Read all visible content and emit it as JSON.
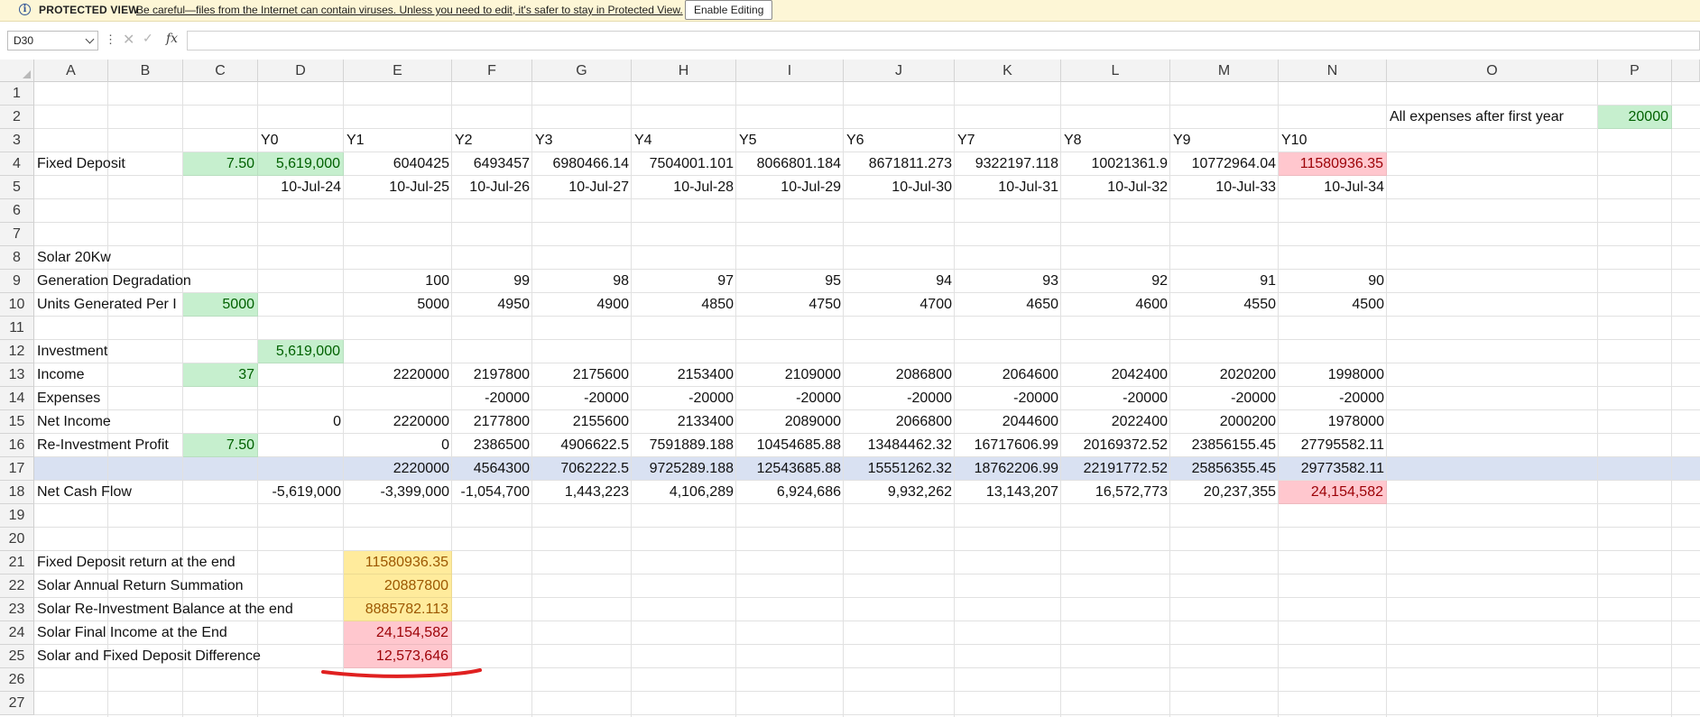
{
  "protected_view": {
    "icon": "info-icon",
    "label": "PROTECTED VIEW",
    "message": "Be careful—files from the Internet can contain viruses. Unless you need to edit, it's safer to stay in Protected View.",
    "button": "Enable Editing"
  },
  "formula_bar": {
    "name_box": "D30",
    "dots": "⋮",
    "cancel": "✕",
    "enter": "✓",
    "fx": "fx",
    "content": ""
  },
  "colors": {
    "green": "#c6efce",
    "red": "#ffc7ce",
    "yellow": "#ffeb9c",
    "blue_band": "#d9e1f2",
    "annotation": "#e02020"
  },
  "columns": [
    "A",
    "B",
    "C",
    "D",
    "E",
    "F",
    "G",
    "H",
    "I",
    "J",
    "K",
    "L",
    "M",
    "N",
    "O",
    "P"
  ],
  "rows": [
    "1",
    "2",
    "3",
    "4",
    "5",
    "6",
    "7",
    "8",
    "9",
    "10",
    "11",
    "12",
    "13",
    "14",
    "15",
    "16",
    "17",
    "18",
    "19",
    "20",
    "21",
    "22",
    "23",
    "24",
    "25",
    "26",
    "27"
  ],
  "cells": [
    {
      "ref": "O2",
      "text": "All expenses after first year",
      "align": "l"
    },
    {
      "ref": "P2",
      "text": "20000",
      "align": "r",
      "fill": "green"
    },
    {
      "ref": "D3",
      "text": "Y0",
      "align": "l"
    },
    {
      "ref": "E3",
      "text": "Y1",
      "align": "l"
    },
    {
      "ref": "F3",
      "text": "Y2",
      "align": "l"
    },
    {
      "ref": "G3",
      "text": "Y3",
      "align": "l"
    },
    {
      "ref": "H3",
      "text": "Y4",
      "align": "l"
    },
    {
      "ref": "I3",
      "text": "Y5",
      "align": "l"
    },
    {
      "ref": "J3",
      "text": "Y6",
      "align": "l"
    },
    {
      "ref": "K3",
      "text": "Y7",
      "align": "l"
    },
    {
      "ref": "L3",
      "text": "Y8",
      "align": "l"
    },
    {
      "ref": "M3",
      "text": "Y9",
      "align": "l"
    },
    {
      "ref": "N3",
      "text": "Y10",
      "align": "l"
    },
    {
      "ref": "A4",
      "text": "Fixed Deposit",
      "align": "l"
    },
    {
      "ref": "C4",
      "text": "7.50",
      "align": "r",
      "fill": "green"
    },
    {
      "ref": "D4",
      "text": "5,619,000",
      "align": "r",
      "fill": "green"
    },
    {
      "ref": "E4",
      "text": "6040425",
      "align": "r"
    },
    {
      "ref": "F4",
      "text": "6493457",
      "align": "r"
    },
    {
      "ref": "G4",
      "text": "6980466.14",
      "align": "r"
    },
    {
      "ref": "H4",
      "text": "7504001.101",
      "align": "r"
    },
    {
      "ref": "I4",
      "text": "8066801.184",
      "align": "r"
    },
    {
      "ref": "J4",
      "text": "8671811.273",
      "align": "r"
    },
    {
      "ref": "K4",
      "text": "9322197.118",
      "align": "r"
    },
    {
      "ref": "L4",
      "text": "10021361.9",
      "align": "r"
    },
    {
      "ref": "M4",
      "text": "10772964.04",
      "align": "r"
    },
    {
      "ref": "N4",
      "text": "11580936.35",
      "align": "r",
      "fill": "red"
    },
    {
      "ref": "D5",
      "text": "10-Jul-24",
      "align": "r"
    },
    {
      "ref": "E5",
      "text": "10-Jul-25",
      "align": "r"
    },
    {
      "ref": "F5",
      "text": "10-Jul-26",
      "align": "r"
    },
    {
      "ref": "G5",
      "text": "10-Jul-27",
      "align": "r"
    },
    {
      "ref": "H5",
      "text": "10-Jul-28",
      "align": "r"
    },
    {
      "ref": "I5",
      "text": "10-Jul-29",
      "align": "r"
    },
    {
      "ref": "J5",
      "text": "10-Jul-30",
      "align": "r"
    },
    {
      "ref": "K5",
      "text": "10-Jul-31",
      "align": "r"
    },
    {
      "ref": "L5",
      "text": "10-Jul-32",
      "align": "r"
    },
    {
      "ref": "M5",
      "text": "10-Jul-33",
      "align": "r"
    },
    {
      "ref": "N5",
      "text": "10-Jul-34",
      "align": "r"
    },
    {
      "ref": "A8",
      "text": "Solar 20Kw",
      "align": "l"
    },
    {
      "ref": "A9",
      "text": "Generation Degradation",
      "align": "l"
    },
    {
      "ref": "E9",
      "text": "100",
      "align": "r"
    },
    {
      "ref": "F9",
      "text": "99",
      "align": "r"
    },
    {
      "ref": "G9",
      "text": "98",
      "align": "r"
    },
    {
      "ref": "H9",
      "text": "97",
      "align": "r"
    },
    {
      "ref": "I9",
      "text": "95",
      "align": "r"
    },
    {
      "ref": "J9",
      "text": "94",
      "align": "r"
    },
    {
      "ref": "K9",
      "text": "93",
      "align": "r"
    },
    {
      "ref": "L9",
      "text": "92",
      "align": "r"
    },
    {
      "ref": "M9",
      "text": "91",
      "align": "r"
    },
    {
      "ref": "N9",
      "text": "90",
      "align": "r"
    },
    {
      "ref": "A10",
      "text": "Units Generated Per I",
      "align": "l"
    },
    {
      "ref": "C10",
      "text": "5000",
      "align": "r",
      "fill": "green"
    },
    {
      "ref": "E10",
      "text": "5000",
      "align": "r"
    },
    {
      "ref": "F10",
      "text": "4950",
      "align": "r"
    },
    {
      "ref": "G10",
      "text": "4900",
      "align": "r"
    },
    {
      "ref": "H10",
      "text": "4850",
      "align": "r"
    },
    {
      "ref": "I10",
      "text": "4750",
      "align": "r"
    },
    {
      "ref": "J10",
      "text": "4700",
      "align": "r"
    },
    {
      "ref": "K10",
      "text": "4650",
      "align": "r"
    },
    {
      "ref": "L10",
      "text": "4600",
      "align": "r"
    },
    {
      "ref": "M10",
      "text": "4550",
      "align": "r"
    },
    {
      "ref": "N10",
      "text": "4500",
      "align": "r"
    },
    {
      "ref": "A12",
      "text": "Investment",
      "align": "l"
    },
    {
      "ref": "D12",
      "text": "5,619,000",
      "align": "r",
      "fill": "green"
    },
    {
      "ref": "A13",
      "text": "Income",
      "align": "l"
    },
    {
      "ref": "C13",
      "text": "37",
      "align": "r",
      "fill": "green"
    },
    {
      "ref": "E13",
      "text": "2220000",
      "align": "r"
    },
    {
      "ref": "F13",
      "text": "2197800",
      "align": "r"
    },
    {
      "ref": "G13",
      "text": "2175600",
      "align": "r"
    },
    {
      "ref": "H13",
      "text": "2153400",
      "align": "r"
    },
    {
      "ref": "I13",
      "text": "2109000",
      "align": "r"
    },
    {
      "ref": "J13",
      "text": "2086800",
      "align": "r"
    },
    {
      "ref": "K13",
      "text": "2064600",
      "align": "r"
    },
    {
      "ref": "L13",
      "text": "2042400",
      "align": "r"
    },
    {
      "ref": "M13",
      "text": "2020200",
      "align": "r"
    },
    {
      "ref": "N13",
      "text": "1998000",
      "align": "r"
    },
    {
      "ref": "A14",
      "text": "Expenses",
      "align": "l"
    },
    {
      "ref": "F14",
      "text": "-20000",
      "align": "r"
    },
    {
      "ref": "G14",
      "text": "-20000",
      "align": "r"
    },
    {
      "ref": "H14",
      "text": "-20000",
      "align": "r"
    },
    {
      "ref": "I14",
      "text": "-20000",
      "align": "r"
    },
    {
      "ref": "J14",
      "text": "-20000",
      "align": "r"
    },
    {
      "ref": "K14",
      "text": "-20000",
      "align": "r"
    },
    {
      "ref": "L14",
      "text": "-20000",
      "align": "r"
    },
    {
      "ref": "M14",
      "text": "-20000",
      "align": "r"
    },
    {
      "ref": "N14",
      "text": "-20000",
      "align": "r"
    },
    {
      "ref": "A15",
      "text": "Net Income",
      "align": "l"
    },
    {
      "ref": "D15",
      "text": "0",
      "align": "r"
    },
    {
      "ref": "E15",
      "text": "2220000",
      "align": "r"
    },
    {
      "ref": "F15",
      "text": "2177800",
      "align": "r"
    },
    {
      "ref": "G15",
      "text": "2155600",
      "align": "r"
    },
    {
      "ref": "H15",
      "text": "2133400",
      "align": "r"
    },
    {
      "ref": "I15",
      "text": "2089000",
      "align": "r"
    },
    {
      "ref": "J15",
      "text": "2066800",
      "align": "r"
    },
    {
      "ref": "K15",
      "text": "2044600",
      "align": "r"
    },
    {
      "ref": "L15",
      "text": "2022400",
      "align": "r"
    },
    {
      "ref": "M15",
      "text": "2000200",
      "align": "r"
    },
    {
      "ref": "N15",
      "text": "1978000",
      "align": "r"
    },
    {
      "ref": "A16",
      "text": "Re-Investment Profit",
      "align": "l"
    },
    {
      "ref": "C16",
      "text": "7.50",
      "align": "r",
      "fill": "green"
    },
    {
      "ref": "E16",
      "text": "0",
      "align": "r"
    },
    {
      "ref": "F16",
      "text": "2386500",
      "align": "r"
    },
    {
      "ref": "G16",
      "text": "4906622.5",
      "align": "r"
    },
    {
      "ref": "H16",
      "text": "7591889.188",
      "align": "r"
    },
    {
      "ref": "I16",
      "text": "10454685.88",
      "align": "r"
    },
    {
      "ref": "J16",
      "text": "13484462.32",
      "align": "r"
    },
    {
      "ref": "K16",
      "text": "16717606.99",
      "align": "r"
    },
    {
      "ref": "L16",
      "text": "20169372.52",
      "align": "r"
    },
    {
      "ref": "M16",
      "text": "23856155.45",
      "align": "r"
    },
    {
      "ref": "N16",
      "text": "27795582.11",
      "align": "r"
    },
    {
      "ref": "E17",
      "text": "2220000",
      "align": "r"
    },
    {
      "ref": "F17",
      "text": "4564300",
      "align": "r"
    },
    {
      "ref": "G17",
      "text": "7062222.5",
      "align": "r"
    },
    {
      "ref": "H17",
      "text": "9725289.188",
      "align": "r"
    },
    {
      "ref": "I17",
      "text": "12543685.88",
      "align": "r"
    },
    {
      "ref": "J17",
      "text": "15551262.32",
      "align": "r"
    },
    {
      "ref": "K17",
      "text": "18762206.99",
      "align": "r"
    },
    {
      "ref": "L17",
      "text": "22191772.52",
      "align": "r"
    },
    {
      "ref": "M17",
      "text": "25856355.45",
      "align": "r"
    },
    {
      "ref": "N17",
      "text": "29773582.11",
      "align": "r"
    },
    {
      "ref": "A18",
      "text": "Net Cash Flow",
      "align": "l"
    },
    {
      "ref": "D18",
      "text": "-5,619,000",
      "align": "r"
    },
    {
      "ref": "E18",
      "text": "-3,399,000",
      "align": "r"
    },
    {
      "ref": "F18",
      "text": "-1,054,700",
      "align": "r"
    },
    {
      "ref": "G18",
      "text": "1,443,223",
      "align": "r"
    },
    {
      "ref": "H18",
      "text": "4,106,289",
      "align": "r"
    },
    {
      "ref": "I18",
      "text": "6,924,686",
      "align": "r"
    },
    {
      "ref": "J18",
      "text": "9,932,262",
      "align": "r"
    },
    {
      "ref": "K18",
      "text": "13,143,207",
      "align": "r"
    },
    {
      "ref": "L18",
      "text": "16,572,773",
      "align": "r"
    },
    {
      "ref": "M18",
      "text": "20,237,355",
      "align": "r"
    },
    {
      "ref": "N18",
      "text": "24,154,582",
      "align": "r",
      "fill": "red"
    },
    {
      "ref": "A21",
      "text": "Fixed Deposit return at the end",
      "align": "l"
    },
    {
      "ref": "E21",
      "text": "11580936.35",
      "align": "r",
      "fill": "yellow"
    },
    {
      "ref": "A22",
      "text": "Solar Annual Return Summation",
      "align": "l"
    },
    {
      "ref": "E22",
      "text": "20887800",
      "align": "r",
      "fill": "yellow"
    },
    {
      "ref": "A23",
      "text": "Solar Re-Investment Balance at the end",
      "align": "l"
    },
    {
      "ref": "E23",
      "text": "8885782.113",
      "align": "r",
      "fill": "yellow"
    },
    {
      "ref": "A24",
      "text": "Solar Final Income at the End",
      "align": "l"
    },
    {
      "ref": "E24",
      "text": "24,154,582",
      "align": "r",
      "fill": "red"
    },
    {
      "ref": "A25",
      "text": "Solar and Fixed Deposit Difference",
      "align": "l"
    },
    {
      "ref": "E25",
      "text": "12,573,646",
      "align": "r",
      "fill": "red"
    }
  ]
}
